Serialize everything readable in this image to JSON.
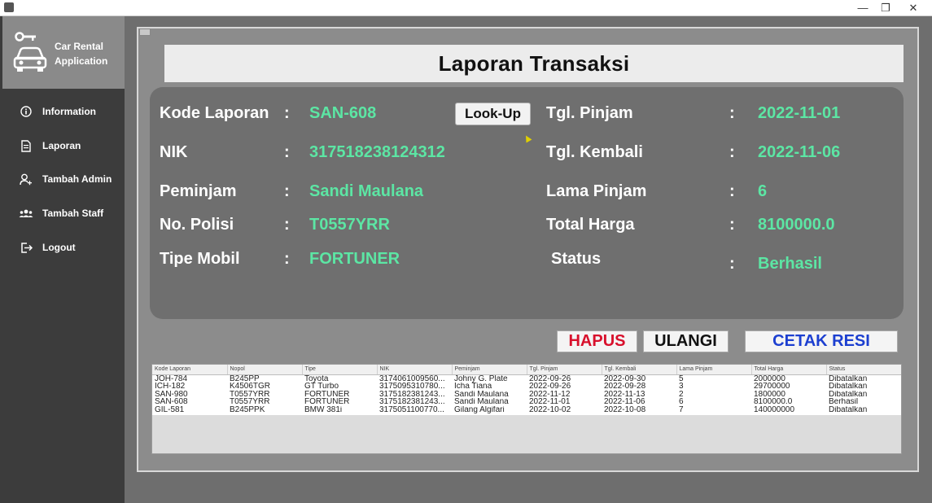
{
  "app": {
    "brand_line1": "Car Rental",
    "brand_line2": "Application"
  },
  "window": {
    "minimize": "—",
    "maximize": "❐",
    "close": "✕"
  },
  "sidebar": {
    "items": [
      {
        "label": "Information",
        "icon": "info-icon"
      },
      {
        "label": "Laporan",
        "icon": "document-icon"
      },
      {
        "label": "Tambah Admin",
        "icon": "add-user-icon"
      },
      {
        "label": "Tambah Staff",
        "icon": "group-icon"
      },
      {
        "label": "Logout",
        "icon": "logout-icon"
      }
    ]
  },
  "page": {
    "title": "Laporan Transaksi"
  },
  "form": {
    "colon": ":",
    "kode_laporan_label": "Kode Laporan",
    "kode_laporan_value": "SAN-608",
    "lookup_label": "Look-Up",
    "nik_label": "NIK",
    "nik_value": "317518238124312",
    "peminjam_label": "Peminjam",
    "peminjam_value": "Sandi Maulana",
    "no_polisi_label": "No. Polisi",
    "no_polisi_value": "T0557YRR",
    "tipe_mobil_label": "Tipe Mobil",
    "tipe_mobil_value": "FORTUNER",
    "tgl_pinjam_label": "Tgl. Pinjam",
    "tgl_pinjam_value": "2022-11-01",
    "tgl_kembali_label": "Tgl. Kembali",
    "tgl_kembali_value": "2022-11-06",
    "lama_pinjam_label": "Lama Pinjam",
    "lama_pinjam_value": "6",
    "total_harga_label": "Total Harga",
    "total_harga_value": "8100000.0",
    "status_label": "Status",
    "status_value": "Berhasil"
  },
  "actions": {
    "hapus": "HAPUS",
    "ulangi": "ULANGI",
    "cetak": "CETAK RESI"
  },
  "table": {
    "columns": [
      "Kode Laporan",
      "Nopol",
      "Tipe",
      "NIK",
      "Peminjam",
      "Tgl. Pinjam",
      "Tgl. Kembali",
      "Lama Pinjam",
      "Total Harga",
      "Status"
    ],
    "rows": [
      [
        "JOH-784",
        "B245PP",
        "Toyota",
        "3174061009560...",
        "Johny G. Plate",
        "2022-09-26",
        "2022-09-30",
        "5",
        "2000000",
        "Dibatalkan"
      ],
      [
        "ICH-182",
        "K4506TGR",
        "GT Turbo",
        "3175095310780...",
        "Icha Tiana",
        "2022-09-26",
        "2022-09-28",
        "3",
        "29700000",
        "Dibatalkan"
      ],
      [
        "SAN-980",
        "T0557YRR",
        "FORTUNER",
        "3175182381243...",
        "Sandi Maulana",
        "2022-11-12",
        "2022-11-13",
        "2",
        "1800000",
        "Dibatalkan"
      ],
      [
        "SAN-608",
        "T0557YRR",
        "FORTUNER",
        "3175182381243...",
        "Sandi Maulana",
        "2022-11-01",
        "2022-11-06",
        "6",
        "8100000.0",
        "Berhasil"
      ],
      [
        "GIL-581",
        "B245PPK",
        "BMW 381i",
        "3175051100770...",
        "Gilang Algifari",
        "2022-10-02",
        "2022-10-08",
        "7",
        "140000000",
        "Dibatalkan"
      ]
    ]
  },
  "colors": {
    "accent_value": "#5ce6a4",
    "hapus": "#d8102c",
    "ulangi": "#111111",
    "cetak": "#1c3fd0"
  }
}
